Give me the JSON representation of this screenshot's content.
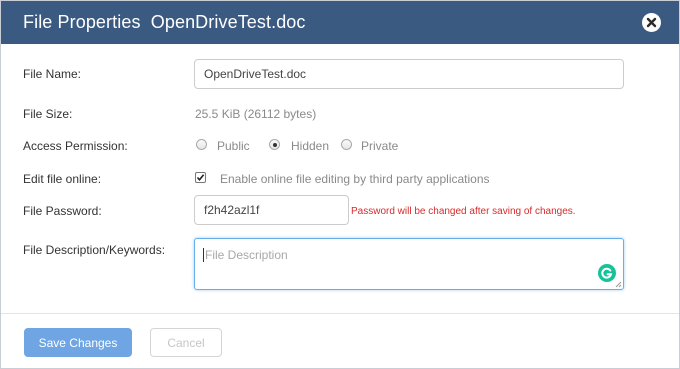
{
  "dialog": {
    "title": "File Properties  OpenDriveTest.doc"
  },
  "form": {
    "file_name_label": "File Name:",
    "file_name_value": "OpenDriveTest.doc",
    "file_size_label": "File Size:",
    "file_size_value": "25.5 KiB (26112 bytes)",
    "access_label": "Access Permission:",
    "access_options": [
      {
        "label": "Public",
        "checked": false
      },
      {
        "label": "Hidden",
        "checked": true
      },
      {
        "label": "Private",
        "checked": false
      }
    ],
    "edit_online_label": "Edit file online:",
    "edit_online_checkbox_label": "Enable online file editing by third party applications",
    "edit_online_checked": true,
    "password_label": "File Password:",
    "password_value": "f2h42azl1f",
    "password_warning": "Password will be changed after saving of changes.",
    "description_label": "File Description/Keywords:",
    "description_placeholder": "File Description",
    "description_value": ""
  },
  "footer": {
    "save_label": "Save Changes",
    "cancel_label": "Cancel"
  },
  "colors": {
    "header_bg": "#3a5a82",
    "primary_button": "#6fa5e3",
    "error_text": "#d62b2b",
    "grammarly": "#15c39a"
  },
  "icons": {
    "close": "close-icon",
    "grammarly": "grammarly-icon",
    "checkmark": "checkmark-icon",
    "resize": "resize-handle-icon"
  }
}
